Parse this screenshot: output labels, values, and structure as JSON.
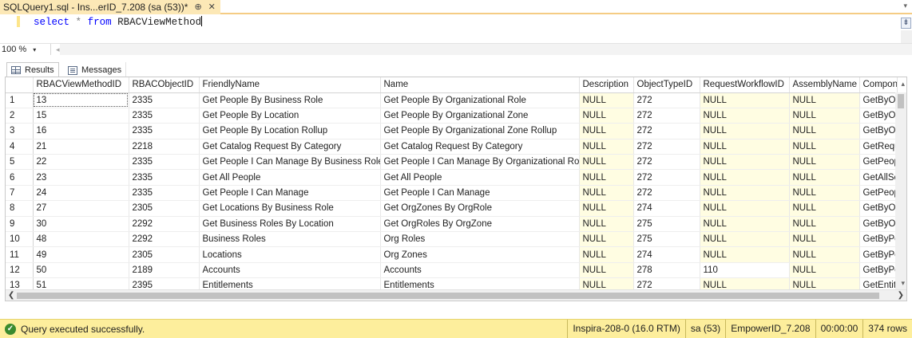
{
  "tab": {
    "title": "SQLQuery1.sql - Ins...erID_7.208 (sa (53))*",
    "pin_glyph": "⊕",
    "close_glyph": "✕",
    "overflow_glyph": "▾"
  },
  "editor": {
    "kw_select": "select",
    "star": "*",
    "kw_from": "from",
    "table": "RBACViewMethod"
  },
  "zoom": {
    "value": "100 %",
    "caret": "▾",
    "scroll_left": "◂"
  },
  "result_tabs": [
    {
      "label": "Results",
      "icon": "grid-icon"
    },
    {
      "label": "Messages",
      "icon": "messages-icon"
    }
  ],
  "grid": {
    "columns": [
      "",
      "RBACViewMethodID",
      "RBACObjectID",
      "FriendlyName",
      "Name",
      "Description",
      "ObjectTypeID",
      "RequestWorkflowID",
      "AssemblyName",
      "Compone"
    ],
    "rows": [
      [
        "1",
        "13",
        "2335",
        "Get People By Business Role",
        "Get People By Organizational Role",
        "NULL",
        "272",
        "NULL",
        "NULL",
        "GetByOr"
      ],
      [
        "2",
        "15",
        "2335",
        "Get People By Location",
        "Get People By Organizational Zone",
        "NULL",
        "272",
        "NULL",
        "NULL",
        "GetByOr"
      ],
      [
        "3",
        "16",
        "2335",
        "Get People By Location Rollup",
        "Get People By Organizational Zone Rollup",
        "NULL",
        "272",
        "NULL",
        "NULL",
        "GetByOr"
      ],
      [
        "4",
        "21",
        "2218",
        "Get Catalog Request By Category",
        "Get Catalog Request By Category",
        "NULL",
        "272",
        "NULL",
        "NULL",
        "GetRequ"
      ],
      [
        "5",
        "22",
        "2335",
        "Get People I Can Manage By Business Role",
        "Get People I Can Manage By Organizational Role",
        "NULL",
        "272",
        "NULL",
        "NULL",
        "GetPeop"
      ],
      [
        "6",
        "23",
        "2335",
        "Get All People",
        "Get All People",
        "NULL",
        "272",
        "NULL",
        "NULL",
        "GetAllSe"
      ],
      [
        "7",
        "24",
        "2335",
        "Get People I Can Manage",
        "Get People I Can Manage",
        "NULL",
        "272",
        "NULL",
        "NULL",
        "GetPeop"
      ],
      [
        "8",
        "27",
        "2305",
        "Get Locations By Business Role",
        "Get OrgZones By OrgRole",
        "NULL",
        "274",
        "NULL",
        "NULL",
        "GetByOr"
      ],
      [
        "9",
        "30",
        "2292",
        "Get Business Roles By Location",
        "Get OrgRoles By OrgZone",
        "NULL",
        "275",
        "NULL",
        "NULL",
        "GetByOr"
      ],
      [
        "10",
        "48",
        "2292",
        "Business Roles",
        "Org Roles",
        "NULL",
        "275",
        "NULL",
        "NULL",
        "GetByPe"
      ],
      [
        "11",
        "49",
        "2305",
        "Locations",
        "Org Zones",
        "NULL",
        "274",
        "NULL",
        "NULL",
        "GetByPe"
      ],
      [
        "12",
        "50",
        "2189",
        "Accounts",
        "Accounts",
        "NULL",
        "278",
        "110",
        "NULL",
        "GetByPe"
      ],
      [
        "13",
        "51",
        "2395",
        "Entitlements",
        "Entitlements",
        "NULL",
        "272",
        "NULL",
        "NULL",
        "GetEntitl"
      ]
    ],
    "scroll_up": "▴",
    "scroll_down": "▾",
    "scroll_left": "❮",
    "scroll_right": "❯"
  },
  "status": {
    "message": "Query executed successfully.",
    "check_glyph": "✓",
    "server": "Inspira-208-0 (16.0 RTM)",
    "user": "sa (53)",
    "database": "EmpowerID_7.208",
    "elapsed": "00:00:00",
    "rows": "374 rows"
  },
  "colors": {
    "tab_bg": "#fce8b6",
    "null_cell_bg": "#fffde2",
    "status_bg": "#fdee9c",
    "keyword": "#0000ff"
  }
}
